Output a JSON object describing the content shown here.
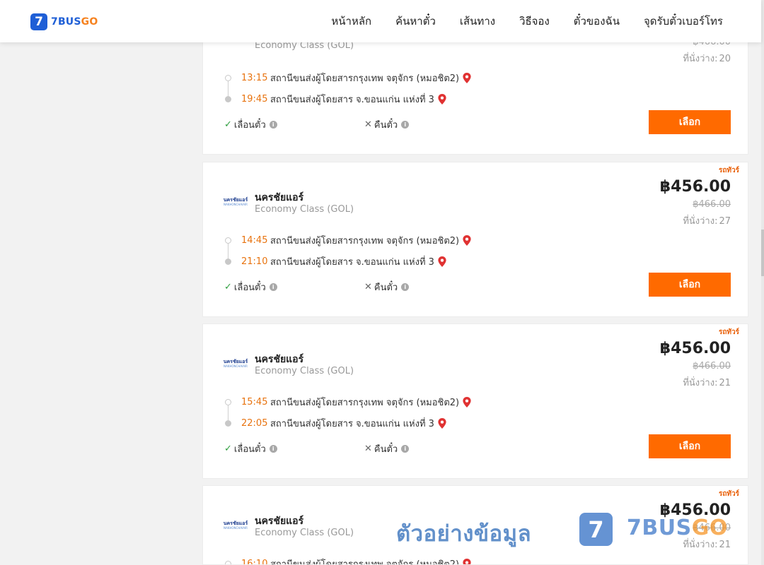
{
  "header": {
    "logo_mark": "7",
    "logo_text_a": "7BUS",
    "logo_text_b": "GO",
    "nav": [
      "หน้าหลัก",
      "ค้นหาตั๋ว",
      "เส้นทาง",
      "วิธีจอง",
      "ตั๋วของฉัน",
      "จุดรับตั๋วเบอร์โทร"
    ]
  },
  "labels": {
    "seats_prefix": "ที่นั่งว่าง:",
    "change_ticket": "เลื่อนตั๋ว",
    "refund_ticket": "คืนตั๋ว",
    "select_button": "เลือก",
    "tag": "รถทัวร์",
    "check_mark": "✓",
    "cross_mark": "✕",
    "info_mark": "i"
  },
  "trips": [
    {
      "operator_logo_a": "",
      "operator_logo_b": "",
      "operator": "",
      "class": "Economy Class (GOL)",
      "price": "",
      "old_price": "฿466.00",
      "seats": "20",
      "depart_time": "13:15",
      "depart_place": "สถานีขนส่งผู้โดยสารกรุงเทพ จตุจักร (หมอชิต2)",
      "arrive_time": "19:45",
      "arrive_place": "สถานีขนส่งผู้โดยสาร จ.ขอนแก่น แห่งที่ 3"
    },
    {
      "operator_logo_a": "นครชัยแอร์",
      "operator_logo_b": "NAKHONCHAIAIR",
      "operator": "นครชัยแอร์",
      "class": "Economy Class (GOL)",
      "price": "฿456.00",
      "old_price": "฿466.00",
      "seats": "27",
      "depart_time": "14:45",
      "depart_place": "สถานีขนส่งผู้โดยสารกรุงเทพ จตุจักร (หมอชิต2)",
      "arrive_time": "21:10",
      "arrive_place": "สถานีขนส่งผู้โดยสาร จ.ขอนแก่น แห่งที่ 3"
    },
    {
      "operator_logo_a": "นครชัยแอร์",
      "operator_logo_b": "NAKHONCHAIAIR",
      "operator": "นครชัยแอร์",
      "class": "Economy Class (GOL)",
      "price": "฿456.00",
      "old_price": "฿466.00",
      "seats": "21",
      "depart_time": "15:45",
      "depart_place": "สถานีขนส่งผู้โดยสารกรุงเทพ จตุจักร (หมอชิต2)",
      "arrive_time": "22:05",
      "arrive_place": "สถานีขนส่งผู้โดยสาร จ.ขอนแก่น แห่งที่ 3"
    },
    {
      "operator_logo_a": "นครชัยแอร์",
      "operator_logo_b": "NAKHONCHAIAIR",
      "operator": "นครชัยแอร์",
      "class": "Economy Class (GOL)",
      "price": "฿456.00",
      "old_price": "฿466.00",
      "seats": "21",
      "depart_time": "16:10",
      "depart_place": "สถานีขนส่งผู้โดยสารกรุงเทพ จตุจักร (หมอชิต2)",
      "arrive_time": "",
      "arrive_place": ""
    }
  ],
  "watermark": {
    "text": "ตัวอย่างข้อมูล",
    "logo_mark": "7",
    "brand_a": "7BUS",
    "brand_b": "GO"
  },
  "colors": {
    "accent": "#ff6a00",
    "time": "#e8730f",
    "brand_blue": "#1f5fd6",
    "brand_orange": "#f6821f"
  }
}
